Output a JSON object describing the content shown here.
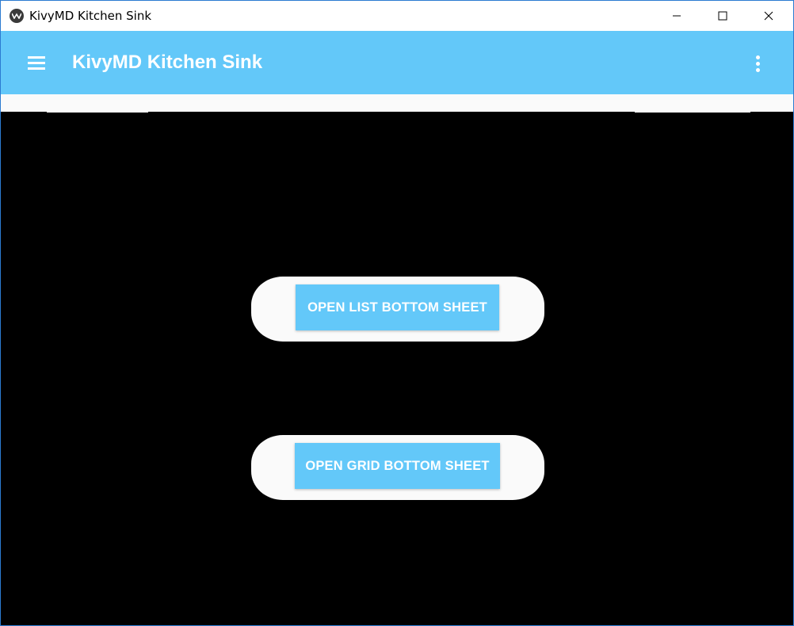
{
  "window": {
    "title": "KivyMD Kitchen Sink",
    "controls": {
      "minimize": "minimize-icon",
      "maximize": "maximize-icon",
      "close": "close-icon"
    }
  },
  "appbar": {
    "title": "KivyMD Kitchen Sink",
    "left_icon": "menu-icon",
    "right_icon": "more-vert-icon",
    "color": "#63c8f9"
  },
  "main": {
    "buttons": [
      {
        "label": "OPEN LIST BOTTOM SHEET"
      },
      {
        "label": "OPEN GRID BOTTOM SHEET"
      }
    ],
    "button_color": "#63c8f9",
    "background": "#000000"
  }
}
